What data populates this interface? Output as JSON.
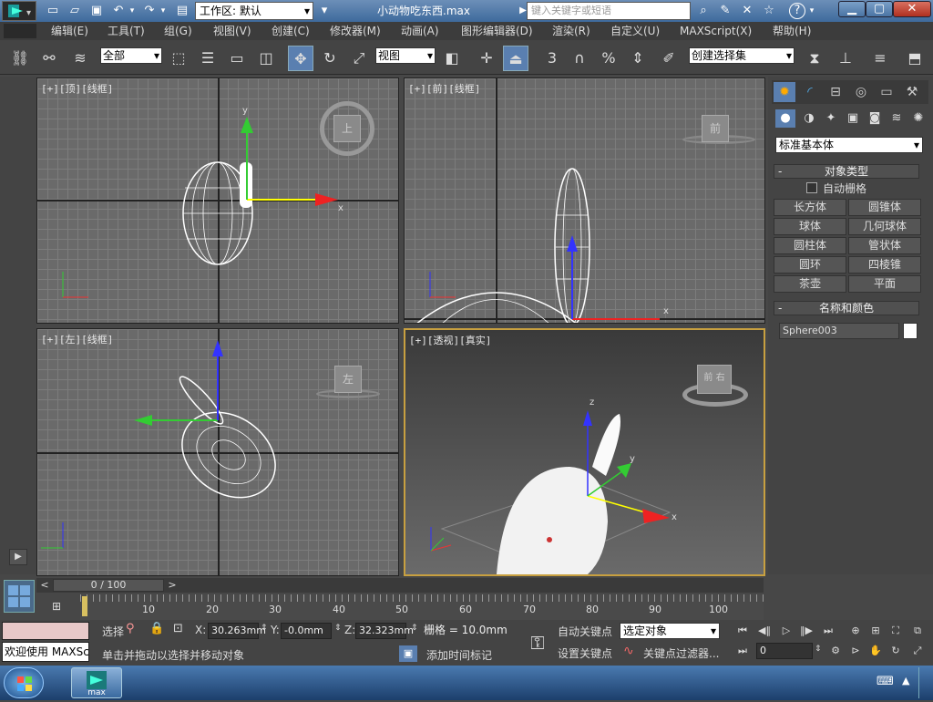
{
  "title_bar": {
    "workspace": "工作区: 默认",
    "file_title": "小动物吃东西.max",
    "search_placeholder": "键入关键字或短语",
    "help": "?"
  },
  "menu": [
    "编辑(E)",
    "工具(T)",
    "组(G)",
    "视图(V)",
    "创建(C)",
    "修改器(M)",
    "动画(A)",
    "图形编辑器(D)",
    "渲染(R)",
    "自定义(U)",
    "MAXScript(X)",
    "帮助(H)"
  ],
  "toolbar": {
    "filter": "全部",
    "ref_coord": "视图",
    "named_selection": "创建选择集",
    "snap_label": "3"
  },
  "viewports": {
    "top": {
      "label": "[+][顶][线框]",
      "cube": "上"
    },
    "front": {
      "label": "[+][前][线框]",
      "cube": "前"
    },
    "left": {
      "label": "[+][左][线框]",
      "cube": "左"
    },
    "persp": {
      "label": "[+][透视][真实]",
      "cube": "前 右"
    },
    "axis_x": "x",
    "axis_y": "y",
    "axis_z": "z"
  },
  "command_panel": {
    "category": "标准基本体",
    "object_type_title": "对象类型",
    "autogrid": "自动栅格",
    "buttons": [
      "长方体",
      "圆锥体",
      "球体",
      "几何球体",
      "圆柱体",
      "管状体",
      "圆环",
      "四棱锥",
      "茶壶",
      "平面"
    ],
    "name_color_title": "名称和颜色",
    "object_name": "Sphere003",
    "object_color": "#ffffff"
  },
  "timeline": {
    "frame_display": "0 / 100",
    "ticks": [
      "10",
      "20",
      "30",
      "40",
      "50",
      "60",
      "70",
      "80",
      "90",
      "100"
    ]
  },
  "status": {
    "welcome": "欢迎使用 MAXSc",
    "prompt": "单击并拖动以选择并移动对象",
    "selection_label": "选择",
    "x_label": "X:",
    "x_value": "30.263mm",
    "y_label": "Y:",
    "y_value": "-0.0mm",
    "z_label": "Z:",
    "z_value": "32.323mm",
    "grid": "栅格 = 10.0mm",
    "add_time_tag": "添加时间标记",
    "auto_key": "自动关键点",
    "set_key": "设置关键点",
    "key_mode": "选定对象",
    "key_filters": "关键点过滤器...",
    "current_frame": "0"
  },
  "taskbar": {
    "app_label": "max"
  }
}
